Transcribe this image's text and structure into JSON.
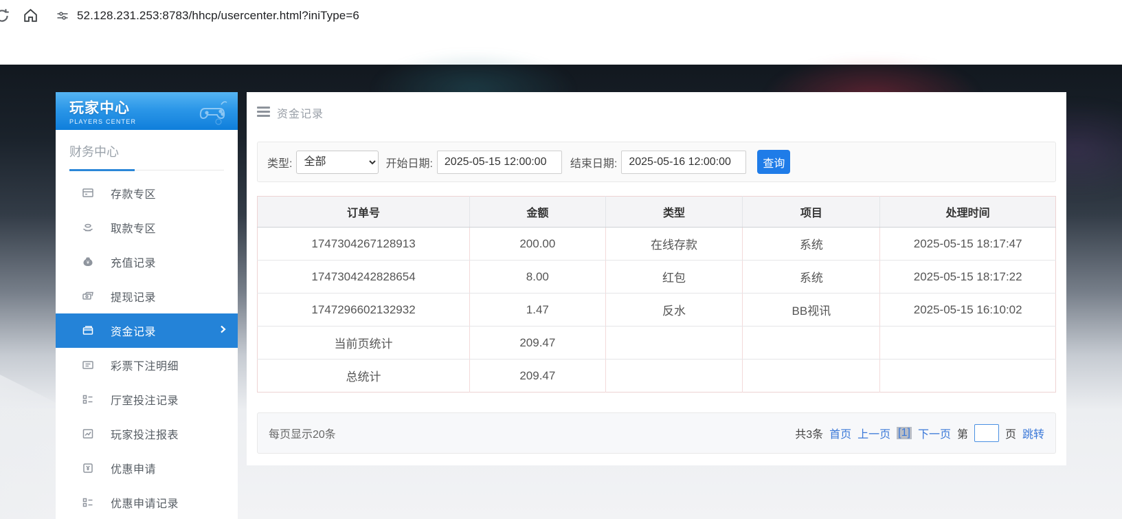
{
  "browser": {
    "url": "52.128.231.253:8783/hhcp/usercenter.html?iniType=6"
  },
  "sidebar": {
    "title": "玩家中心",
    "subtitle": "PLAYERS CENTER",
    "section": "财务中心",
    "items": [
      {
        "label": "存款专区"
      },
      {
        "label": "取款专区"
      },
      {
        "label": "充值记录"
      },
      {
        "label": "提现记录"
      },
      {
        "label": "资金记录"
      },
      {
        "label": "彩票下注明细"
      },
      {
        "label": "厅室投注记录"
      },
      {
        "label": "玩家投注报表"
      },
      {
        "label": "优惠申请"
      },
      {
        "label": "优惠申请记录"
      }
    ]
  },
  "main": {
    "breadcrumb": "资金记录",
    "filters": {
      "type_label": "类型:",
      "type_value": "全部",
      "start_label": "开始日期:",
      "start_value": "2025-05-15 12:00:00",
      "end_label": "结束日期:",
      "end_value": "2025-05-16 12:00:00",
      "search_button": "查询"
    },
    "table": {
      "headers": [
        "订单号",
        "金额",
        "类型",
        "项目",
        "处理时间"
      ],
      "rows": [
        [
          "1747304267128913",
          "200.00",
          "在线存款",
          "系统",
          "2025-05-15 18:17:47"
        ],
        [
          "1747304242828654",
          "8.00",
          "红包",
          "系统",
          "2025-05-15 18:17:22"
        ],
        [
          "1747296602132932",
          "1.47",
          "反水",
          "BB视讯",
          "2025-05-15 16:10:02"
        ],
        [
          "当前页统计",
          "209.47",
          "",
          "",
          ""
        ],
        [
          "总统计",
          "209.47",
          "",
          "",
          ""
        ]
      ]
    },
    "pagination": {
      "page_size_text": "每页显示20条",
      "total_text": "共3条",
      "first": "首页",
      "prev": "上一页",
      "current": "[1]",
      "next": "下一页",
      "jump_prefix": "第",
      "jump_suffix": "页",
      "jump_link": "跳转",
      "jump_value": ""
    }
  },
  "colors": {
    "sidebar_active_blue": "#2483d8",
    "header_gradient_blue": "#1585dc",
    "button_blue": "#1f7ce8",
    "link_blue": "#3a78d8",
    "table_border_pink": "#edd3d3"
  }
}
